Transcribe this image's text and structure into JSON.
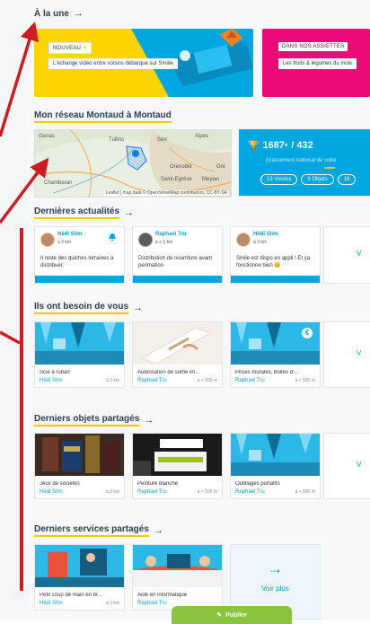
{
  "sections": {
    "a_la_une": "À la une",
    "reseau": "Mon réseau Montaud à Montaud",
    "actualites": "Dernières actualités",
    "besoin": "Ils ont besoin de vous",
    "objets": "Derniers objets partagés",
    "services": "Derniers services partagés"
  },
  "banners": [
    {
      "tag": "NOUVEAU",
      "desc": "L'échange vidéo entre voisins débarque sur Smiile",
      "color": "#ffd500"
    },
    {
      "tag": "DANS NOS ASSIETTES",
      "desc": "Les fruits & légumes du mois",
      "color": "#ea0a78"
    }
  ],
  "map": {
    "places": [
      "Genas",
      "Tullins",
      "Sérr",
      "Alpes",
      "Grenoble",
      "Chambaran",
      "Meylan",
      "Saint-Egrève",
      "Gre"
    ],
    "credit": "Leaflet | map data © OpenStreetMap contributors, CC-BY-SA"
  },
  "stats": {
    "rank": "1687",
    "rank_sup": "e",
    "rank_total": "/ 432",
    "subtitle": "(classement national de votre",
    "pills": [
      "13 Voisins",
      "9 Objets",
      "18"
    ]
  },
  "news": [
    {
      "name": "Hédi Slim",
      "dist": "à 3 km",
      "text": "Il reste des quiches lorraines à distribuer,",
      "avatar_color": "#b88c6a"
    },
    {
      "name": "Raphael Tru",
      "dist": "à < 1 km",
      "text": "Distribution de nourriture avant perimation",
      "avatar_color": "#5b5b5b"
    },
    {
      "name": "Hédi Slim",
      "dist": "à 3 km",
      "text": "Smile est dispo en appli ! Et ça fonctionne bien 😊",
      "avatar_color": "#b88c6a"
    }
  ],
  "news_more": "V",
  "besoin": [
    {
      "title": "Scie à ruban",
      "owner": "Hédi Slim",
      "dist": "à 3 km"
    },
    {
      "title": "Autorisation de sortie im...",
      "owner": "Raphael Tru",
      "dist": "à < 500 m"
    },
    {
      "title": "Prises murales, boites d'...",
      "owner": "Raphael Tru",
      "dist": "à < 500 m"
    }
  ],
  "objets": [
    {
      "title": "Jeux de sociétés",
      "owner": "Hédi Slim",
      "dist": "à 3 km"
    },
    {
      "title": "Peinture blanche",
      "owner": "Raphael Tru",
      "dist": "à < 500 m"
    },
    {
      "title": "Outillages portatifs",
      "owner": "Raphael Tru",
      "dist": "à < 500 m"
    }
  ],
  "services": [
    {
      "title": "Petit coup de main en br...",
      "owner": "Hédi Slim",
      "dist": "à 3 km"
    },
    {
      "title": "Aide en informatique",
      "owner": "Raphael Tru",
      "dist": ""
    }
  ],
  "row_more": "V",
  "voir_plus": "Voir plus",
  "publish": "Publier",
  "colors": {
    "accent": "#00a6df",
    "yellow": "#f5c800",
    "green": "#8bc43f",
    "red": "#cc1d24",
    "pink": "#ea0a78"
  }
}
